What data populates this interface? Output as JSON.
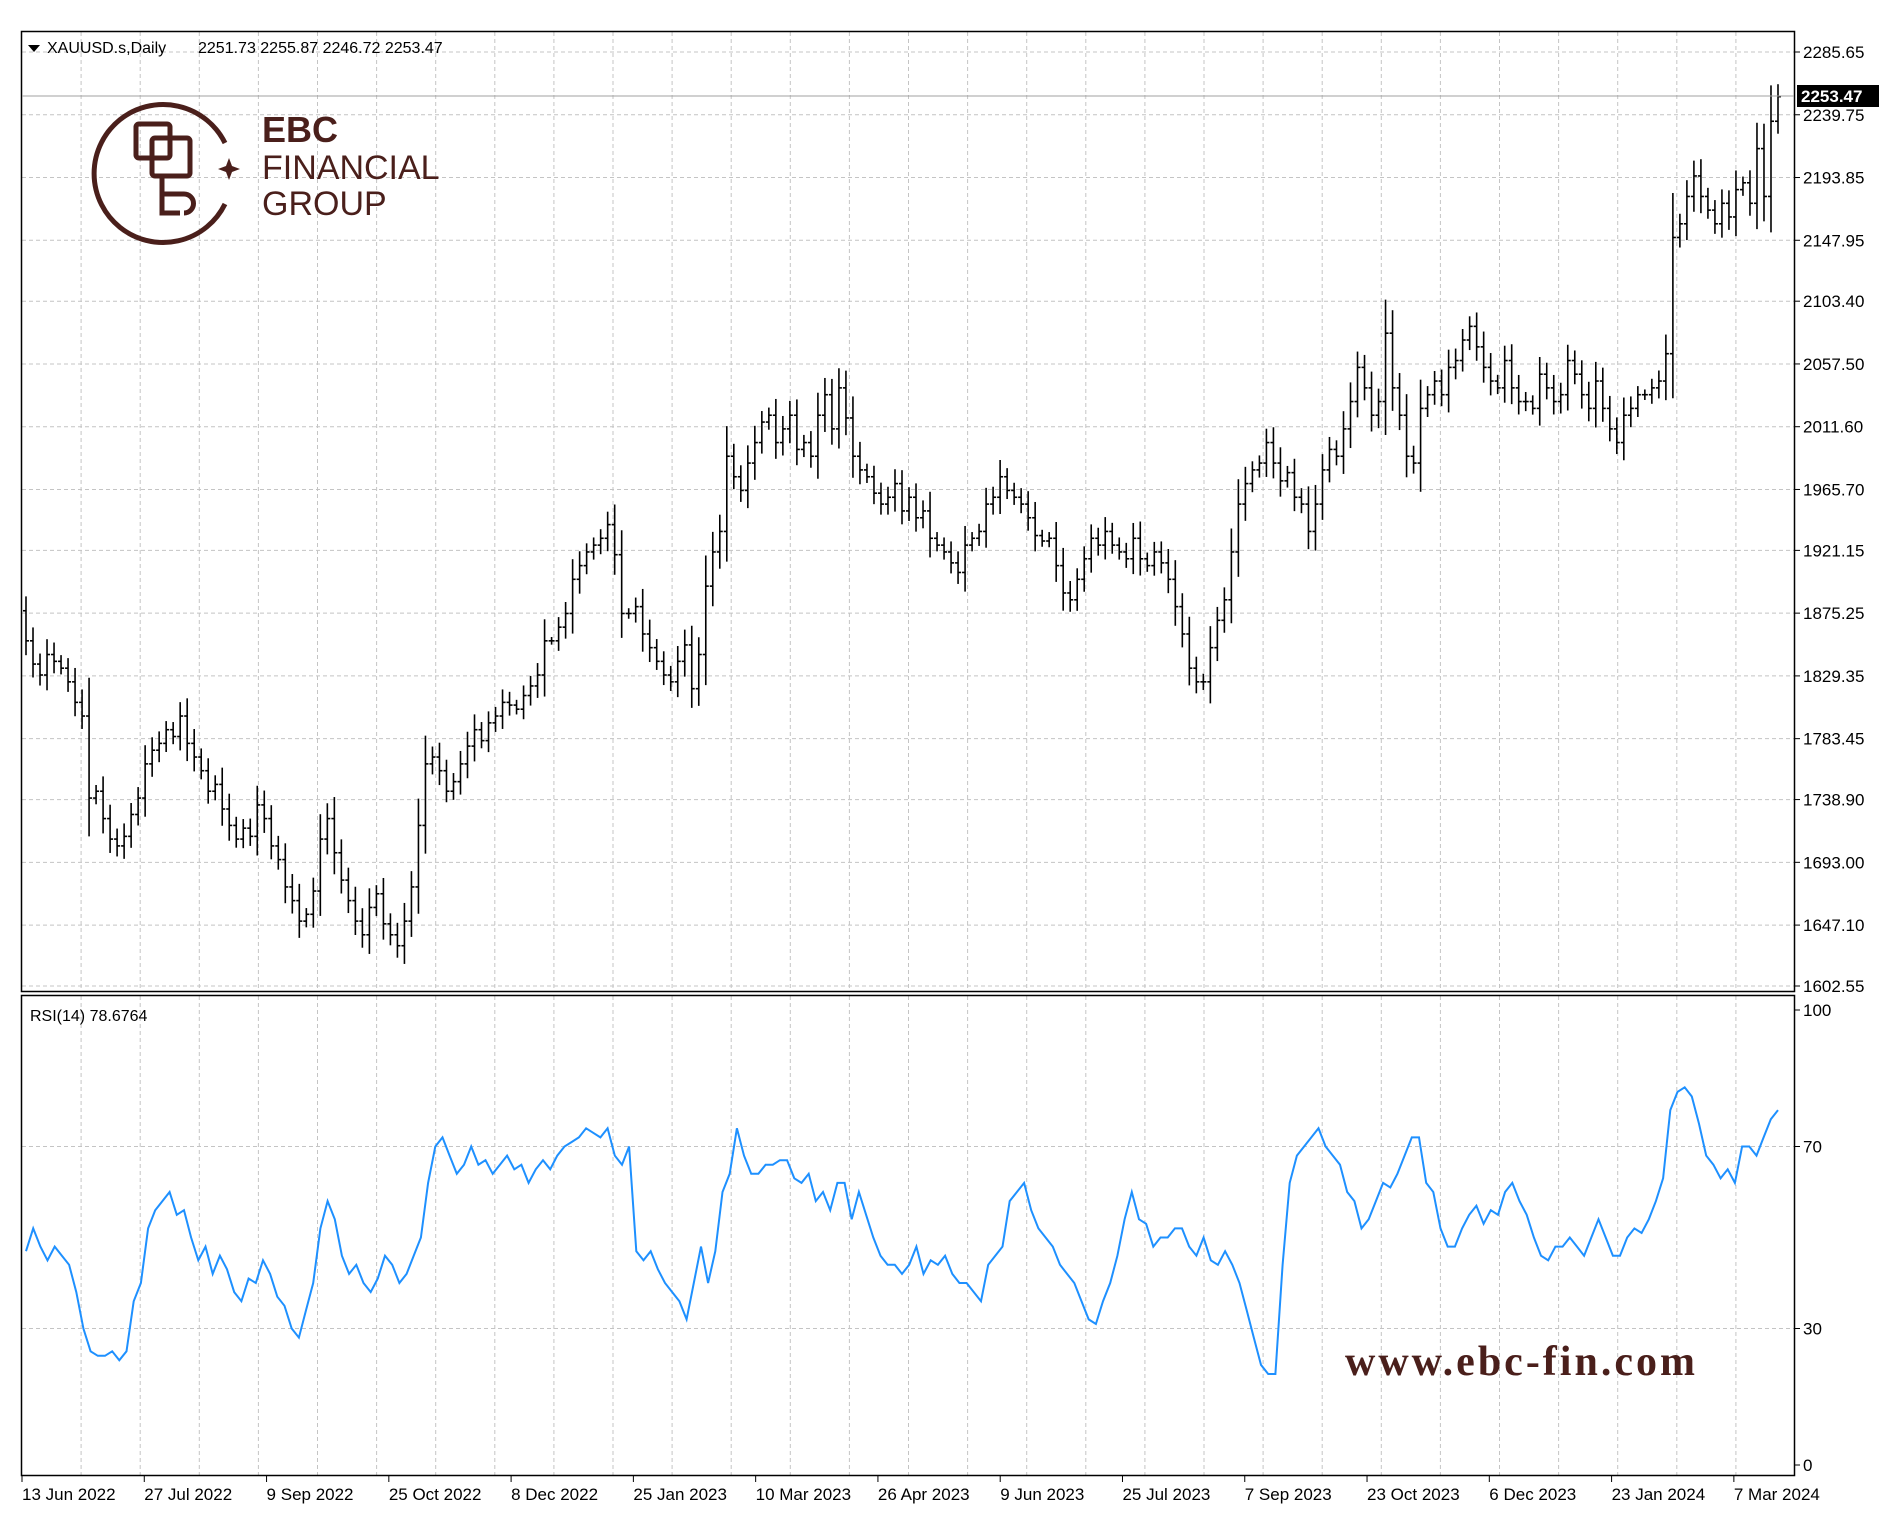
{
  "header": {
    "symbol": "XAUUSD.s,Daily",
    "ohlc": "2251.73 2255.87 2246.72 2253.47"
  },
  "logo": {
    "line1": "EBC",
    "line2": "FINANCIAL",
    "line3": "GROUP"
  },
  "watermark_url": "www.ebc-fin.com",
  "colors": {
    "bars": "#000000",
    "rsi_line": "#1e90ff",
    "grid": "#bcbcbc",
    "brand": "#4a1f1b",
    "price_label_bg": "#000000"
  },
  "chart_data": [
    {
      "type": "line",
      "subtype": "ohlc-bar",
      "title": "XAUUSD.s,Daily",
      "last_price": 2253.47,
      "last_price_label": "2253.47",
      "y_ticks": [
        "2285.65",
        "2239.75",
        "2193.85",
        "2147.95",
        "2103.40",
        "2057.50",
        "2011.60",
        "1965.70",
        "1921.15",
        "1875.25",
        "1829.35",
        "1783.45",
        "1738.90",
        "1693.00",
        "1647.10",
        "1602.55"
      ],
      "ylim": [
        1602.55,
        2285.65
      ],
      "x_ticks": [
        "13 Jun 2022",
        "27 Jul 2022",
        "9 Sep 2022",
        "25 Oct 2022",
        "8 Dec 2022",
        "25 Jan 2023",
        "10 Mar 2023",
        "26 Apr 2023",
        "9 Jun 2023",
        "25 Jul 2023",
        "7 Sep 2023",
        "23 Oct 2023",
        "6 Dec 2023",
        "23 Jan 2024",
        "7 Mar 2024"
      ],
      "grid": true,
      "series": [
        {
          "values": [
            1855,
            1838,
            1830,
            1845,
            1840,
            1835,
            1825,
            1810,
            1800,
            1740,
            1745,
            1725,
            1710,
            1705,
            1712,
            1728,
            1740,
            1765,
            1775,
            1780,
            1790,
            1785,
            1800,
            1780,
            1770,
            1760,
            1745,
            1750,
            1732,
            1720,
            1710,
            1718,
            1712,
            1735,
            1725,
            1705,
            1695,
            1675,
            1665,
            1650,
            1655,
            1672,
            1710,
            1725,
            1700,
            1680,
            1665,
            1650,
            1640,
            1660,
            1670,
            1648,
            1640,
            1632,
            1650,
            1675,
            1720,
            1765,
            1770,
            1760,
            1745,
            1752,
            1765,
            1778,
            1790,
            1782,
            1795,
            1800,
            1810,
            1808,
            1805,
            1815,
            1822,
            1830,
            1855,
            1855,
            1865,
            1875,
            1900,
            1910,
            1920,
            1925,
            1930,
            1940,
            1918,
            1875,
            1875,
            1880,
            1860,
            1850,
            1840,
            1830,
            1825,
            1840,
            1852,
            1820,
            1845,
            1895,
            1920,
            1935,
            1990,
            1975,
            1965,
            1985,
            2000,
            2015,
            2020,
            2000,
            2010,
            2020,
            1995,
            2000,
            1990,
            2020,
            2035,
            2010,
            2040,
            2018,
            1990,
            1980,
            1975,
            1963,
            1955,
            1960,
            1970,
            1950,
            1960,
            1945,
            1950,
            1930,
            1925,
            1920,
            1912,
            1905,
            1925,
            1930,
            1935,
            1955,
            1960,
            1975,
            1965,
            1960,
            1955,
            1945,
            1932,
            1928,
            1930,
            1910,
            1890,
            1885,
            1900,
            1915,
            1930,
            1925,
            1935,
            1925,
            1920,
            1915,
            1930,
            1915,
            1910,
            1920,
            1912,
            1900,
            1880,
            1860,
            1835,
            1825,
            1825,
            1850,
            1870,
            1885,
            1920,
            1955,
            1970,
            1980,
            1985,
            2000,
            1985,
            1972,
            1978,
            1960,
            1955,
            1935,
            1955,
            1980,
            1995,
            1990,
            2010,
            2030,
            2055,
            2040,
            2020,
            2030,
            2080,
            2040,
            2020,
            1990,
            1985,
            2025,
            2035,
            2045,
            2035,
            2055,
            2060,
            2075,
            2085,
            2070,
            2055,
            2045,
            2040,
            2060,
            2040,
            2030,
            2030,
            2025,
            2050,
            2040,
            2030,
            2035,
            2060,
            2050,
            2035,
            2025,
            2045,
            2025,
            2010,
            2000,
            2020,
            2025,
            2035,
            2035,
            2040,
            2045,
            2065,
            2150,
            2160,
            2180,
            2195,
            2180,
            2170,
            2160,
            2175,
            2165,
            2185,
            2190,
            2175,
            2215,
            2180,
            2235,
            2253
          ]
        }
      ]
    },
    {
      "type": "line",
      "title": "RSI(14) 78.6764",
      "y_ticks": [
        "100",
        "70",
        "30",
        "0"
      ],
      "ylim": [
        0,
        100
      ],
      "grid": true,
      "series": [
        {
          "name": "RSI(14)",
          "values": [
            47,
            52,
            48,
            45,
            48,
            46,
            44,
            38,
            30,
            25,
            24,
            24,
            25,
            23,
            25,
            36,
            40,
            52,
            56,
            58,
            60,
            55,
            56,
            50,
            45,
            48,
            42,
            46,
            43,
            38,
            36,
            41,
            40,
            45,
            42,
            37,
            35,
            30,
            28,
            34,
            40,
            52,
            58,
            54,
            46,
            42,
            44,
            40,
            38,
            41,
            46,
            44,
            40,
            42,
            46,
            50,
            62,
            70,
            72,
            68,
            64,
            66,
            70,
            66,
            67,
            64,
            66,
            68,
            65,
            66,
            62,
            65,
            67,
            65,
            68,
            70,
            71,
            72,
            74,
            73,
            72,
            74,
            68,
            66,
            70,
            47,
            45,
            47,
            43,
            40,
            38,
            36,
            32,
            40,
            48,
            40,
            47,
            60,
            64,
            74,
            68,
            64,
            64,
            66,
            66,
            67,
            67,
            63,
            62,
            64,
            58,
            60,
            56,
            62,
            62,
            54,
            60,
            55,
            50,
            46,
            44,
            44,
            42,
            44,
            48,
            42,
            45,
            44,
            46,
            42,
            40,
            40,
            38,
            36,
            44,
            46,
            48,
            58,
            60,
            62,
            56,
            52,
            50,
            48,
            44,
            42,
            40,
            36,
            32,
            31,
            36,
            40,
            46,
            54,
            60,
            54,
            53,
            48,
            50,
            50,
            52,
            52,
            48,
            46,
            50,
            45,
            44,
            47,
            44,
            40,
            34,
            28,
            22,
            20,
            20,
            44,
            62,
            68,
            70,
            72,
            74,
            70,
            68,
            66,
            60,
            58,
            52,
            54,
            58,
            62,
            61,
            64,
            68,
            72,
            72,
            62,
            60,
            52,
            48,
            48,
            52,
            55,
            57,
            53,
            56,
            55,
            60,
            62,
            58,
            55,
            50,
            46,
            45,
            48,
            48,
            50,
            48,
            46,
            50,
            54,
            50,
            46,
            46,
            50,
            52,
            51,
            54,
            58,
            63,
            78,
            82,
            83,
            81,
            75,
            68,
            66,
            63,
            65,
            62,
            70,
            70,
            68,
            72,
            76,
            78
          ]
        }
      ]
    }
  ]
}
